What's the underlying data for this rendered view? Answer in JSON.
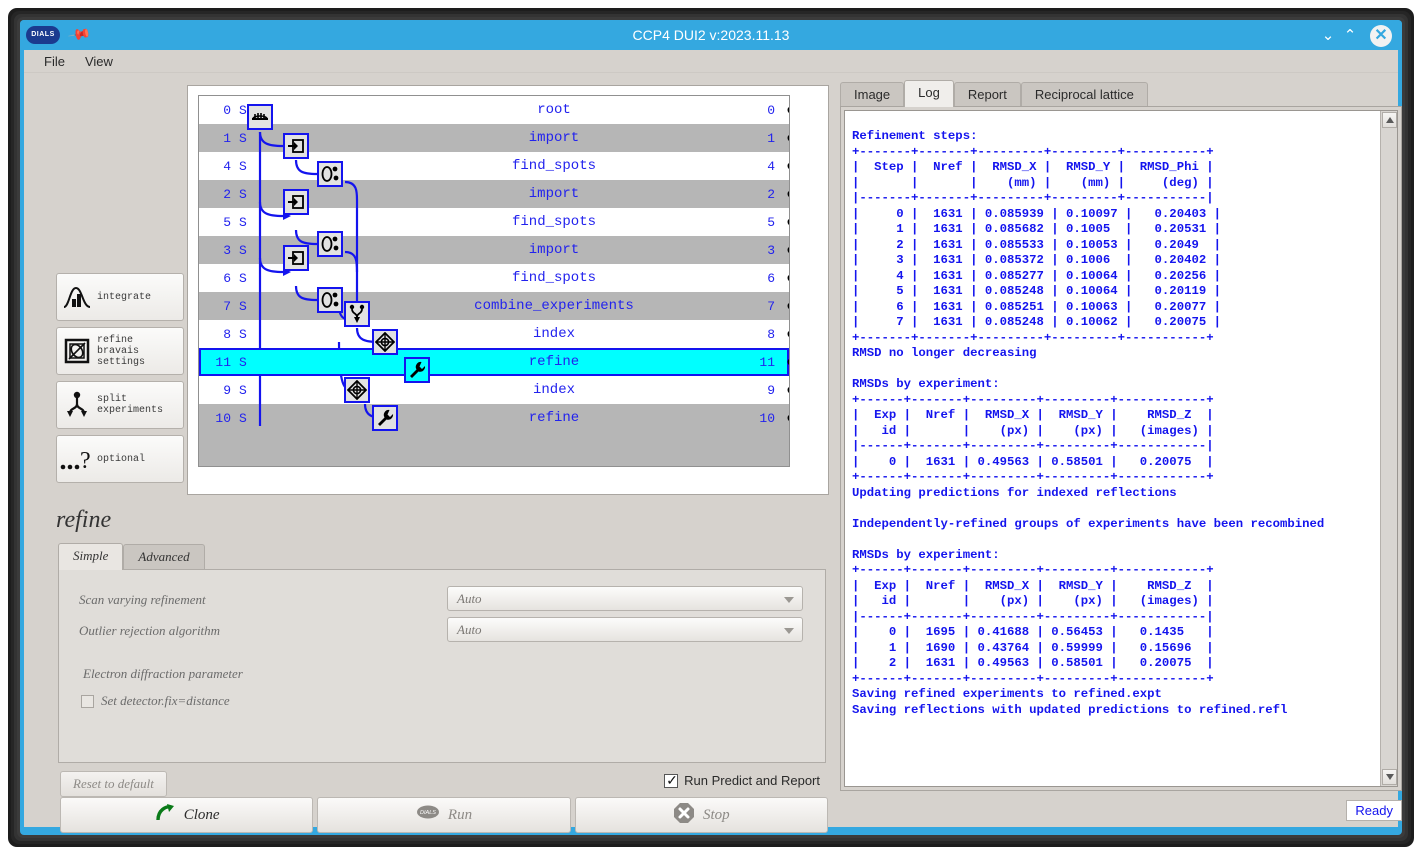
{
  "window": {
    "title": "CCP4 DUI2 v:2023.11.13",
    "logo_text": "DIALS",
    "pin_icon": "pin-icon",
    "minimize": "⌄",
    "maximize": "⌃",
    "close": "✕"
  },
  "menu": {
    "items": [
      "File",
      "View"
    ]
  },
  "tree": {
    "rows": [
      {
        "id": "0",
        "flag": "S",
        "name": "root",
        "num": "0",
        "icon": "root-icon",
        "indent": 0,
        "selected": false,
        "stripe": "white"
      },
      {
        "id": "1",
        "flag": "S",
        "name": "import",
        "num": "1",
        "icon": "import-icon",
        "indent": 1,
        "selected": false,
        "stripe": "grey"
      },
      {
        "id": "4",
        "flag": "S",
        "name": "find_spots",
        "num": "4",
        "icon": "findspots-icon",
        "indent": 2,
        "selected": false,
        "stripe": "white"
      },
      {
        "id": "2",
        "flag": "S",
        "name": "import",
        "num": "2",
        "icon": "import-icon",
        "indent": 1,
        "selected": false,
        "stripe": "grey"
      },
      {
        "id": "5",
        "flag": "S",
        "name": "find_spots",
        "num": "5",
        "icon": "findspots-icon",
        "indent": 2,
        "selected": false,
        "stripe": "white"
      },
      {
        "id": "3",
        "flag": "S",
        "name": "import",
        "num": "3",
        "icon": "import-icon",
        "indent": 1,
        "selected": false,
        "stripe": "grey"
      },
      {
        "id": "6",
        "flag": "S",
        "name": "find_spots",
        "num": "6",
        "icon": "findspots-icon",
        "indent": 2,
        "selected": false,
        "stripe": "white"
      },
      {
        "id": "7",
        "flag": "S",
        "name": "combine_experiments",
        "num": "7",
        "icon": "combine-icon",
        "indent": 3,
        "selected": false,
        "stripe": "grey"
      },
      {
        "id": "8",
        "flag": "S",
        "name": "index",
        "num": "8",
        "icon": "index-icon",
        "indent": 4,
        "selected": false,
        "stripe": "white"
      },
      {
        "id": "11",
        "flag": "S",
        "name": "refine",
        "num": "11",
        "icon": "refine-icon",
        "indent": 5,
        "selected": true,
        "stripe": "grey"
      },
      {
        "id": "9",
        "flag": "S",
        "name": "index",
        "num": "9",
        "icon": "index-icon",
        "indent": 3,
        "selected": false,
        "stripe": "white"
      },
      {
        "id": "10",
        "flag": "S",
        "name": "refine",
        "num": "10",
        "icon": "refine-icon",
        "indent": 4,
        "selected": false,
        "stripe": "grey"
      }
    ],
    "visibility_icon": "hidden-eye-icon",
    "selected_color": "#00ffff",
    "line_color": "#1414ee"
  },
  "sidebar": {
    "buttons": [
      {
        "label": "integrate",
        "icon": "integrate-icon"
      },
      {
        "label": "refine\nbravais\nsettings",
        "icon": "refine-bravais-icon"
      },
      {
        "label": "split\nexperiments",
        "icon": "split-experiments-icon"
      },
      {
        "label": "optional",
        "icon": "optional-icon"
      }
    ]
  },
  "config": {
    "title": "refine",
    "tabs": [
      {
        "label": "Simple",
        "active": true
      },
      {
        "label": "Advanced",
        "active": false
      }
    ],
    "fields": [
      {
        "label": "Scan varying refinement",
        "value": "Auto"
      },
      {
        "label": "Outlier rejection algorithm",
        "value": "Auto"
      }
    ],
    "section_label": "Electron diffraction parameter",
    "checkbox": {
      "label": "Set detector.fix=distance",
      "checked": false
    },
    "reset_label": "Reset to default",
    "predict_report": {
      "label": "Run Predict and Report",
      "checked": true
    },
    "actions": [
      {
        "label": "Clone",
        "icon": "clone-arrow-icon",
        "enabled": true
      },
      {
        "label": "Run",
        "icon": "dials-run-icon",
        "enabled": false
      },
      {
        "label": "Stop",
        "icon": "stop-icon",
        "enabled": false
      }
    ]
  },
  "right": {
    "tabs": [
      {
        "label": "Image",
        "active": false
      },
      {
        "label": "Log",
        "active": true
      },
      {
        "label": "Report",
        "active": false
      },
      {
        "label": "Reciprocal lattice",
        "active": false
      }
    ],
    "status": "Ready",
    "log_text": "Refinement steps:\n+-------+-------+---------+---------+-----------+\n|  Step |  Nref |  RMSD_X |  RMSD_Y |  RMSD_Phi |\n|       |       |    (mm) |    (mm) |     (deg) |\n|-------+-------+---------+---------+-----------|\n|     0 |  1631 | 0.085939 | 0.10097 |   0.20403 |\n|     1 |  1631 | 0.085682 | 0.1005  |   0.20531 |\n|     2 |  1631 | 0.085533 | 0.10053 |   0.2049  |\n|     3 |  1631 | 0.085372 | 0.1006  |   0.20402 |\n|     4 |  1631 | 0.085277 | 0.10064 |   0.20256 |\n|     5 |  1631 | 0.085248 | 0.10064 |   0.20119 |\n|     6 |  1631 | 0.085251 | 0.10063 |   0.20077 |\n|     7 |  1631 | 0.085248 | 0.10062 |   0.20075 |\n+-------+-------+---------+---------+-----------+\nRMSD no longer decreasing\n\nRMSDs by experiment:\n+------+-------+---------+---------+------------+\n|  Exp |  Nref |  RMSD_X |  RMSD_Y |    RMSD_Z  |\n|   id |       |    (px) |    (px) |   (images) |\n|------+-------+---------+---------+------------|\n|    0 |  1631 | 0.49563 | 0.58501 |   0.20075  |\n+------+-------+---------+---------+------------+\nUpdating predictions for indexed reflections\n\nIndependently-refined groups of experiments have been recombined\n\nRMSDs by experiment:\n+------+-------+---------+---------+------------+\n|  Exp |  Nref |  RMSD_X |  RMSD_Y |    RMSD_Z  |\n|   id |       |    (px) |    (px) |   (images) |\n|------+-------+---------+---------+------------|\n|    0 |  1695 | 0.41688 | 0.56453 |   0.1435   |\n|    1 |  1690 | 0.43764 | 0.59999 |   0.15696  |\n|    2 |  1631 | 0.49563 | 0.58501 |   0.20075  |\n+------+-------+---------+---------+------------+\nSaving refined experiments to refined.expt\nSaving reflections with updated predictions to refined.refl"
  }
}
